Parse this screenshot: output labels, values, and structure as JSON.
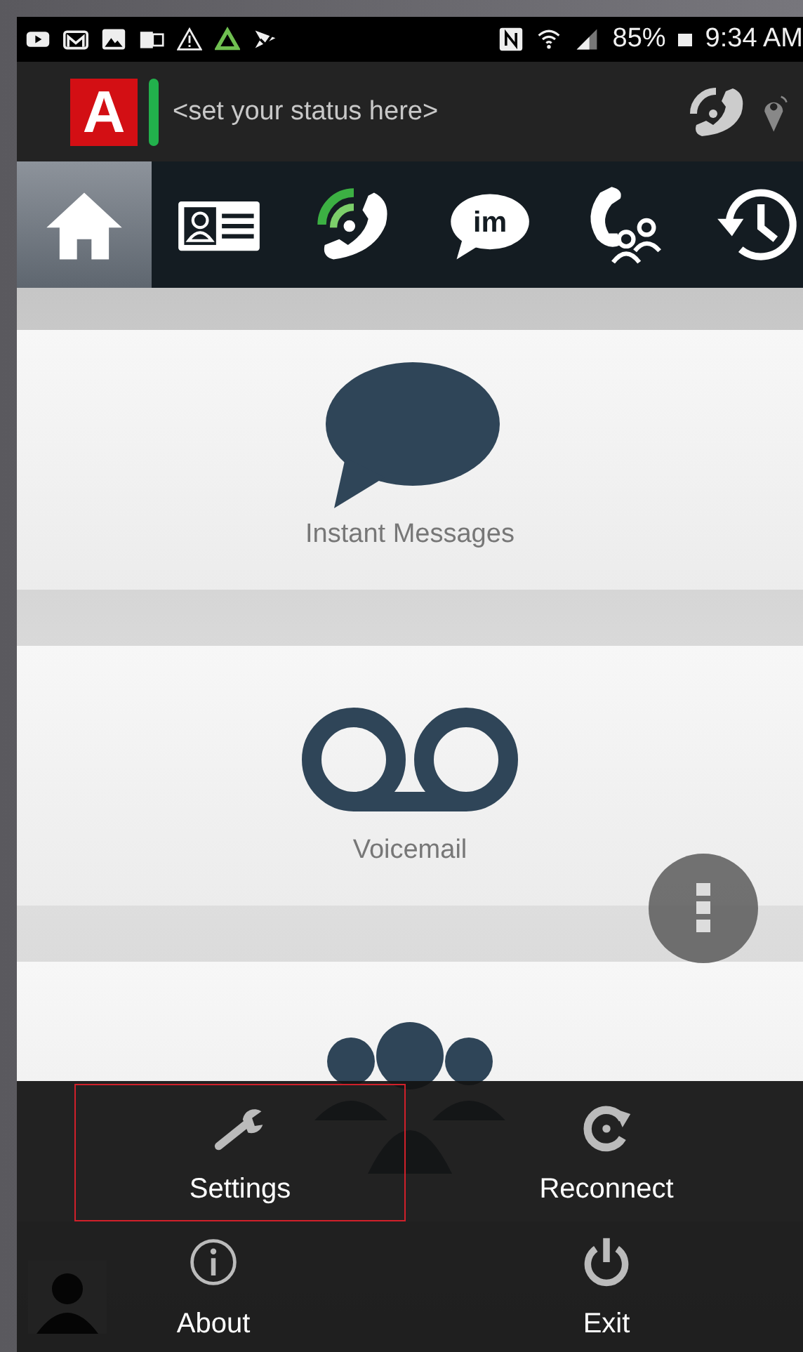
{
  "status_bar": {
    "battery": "85%",
    "time": "9:34 AM"
  },
  "header": {
    "logo": "A",
    "status": {
      "placeholder": "<set your status here>"
    }
  },
  "nav_tabs": [
    {
      "kind": "home",
      "selected": true
    },
    {
      "kind": "contacts",
      "selected": false
    },
    {
      "kind": "calls",
      "selected": false
    },
    {
      "kind": "im",
      "label": "im",
      "selected": false
    },
    {
      "kind": "conference",
      "selected": false
    },
    {
      "kind": "history",
      "selected": false
    }
  ],
  "tiles": [
    {
      "kind": "messages",
      "label": "Instant Messages"
    },
    {
      "kind": "voicemail",
      "label": "Voicemail"
    },
    {
      "kind": "conference"
    }
  ],
  "menu": [
    {
      "kind": "settings",
      "label": "Settings",
      "selected": true
    },
    {
      "kind": "reconnect",
      "label": "Reconnect",
      "selected": false
    },
    {
      "kind": "about",
      "label": "About",
      "selected": false
    },
    {
      "kind": "exit",
      "label": "Exit",
      "selected": false
    }
  ]
}
